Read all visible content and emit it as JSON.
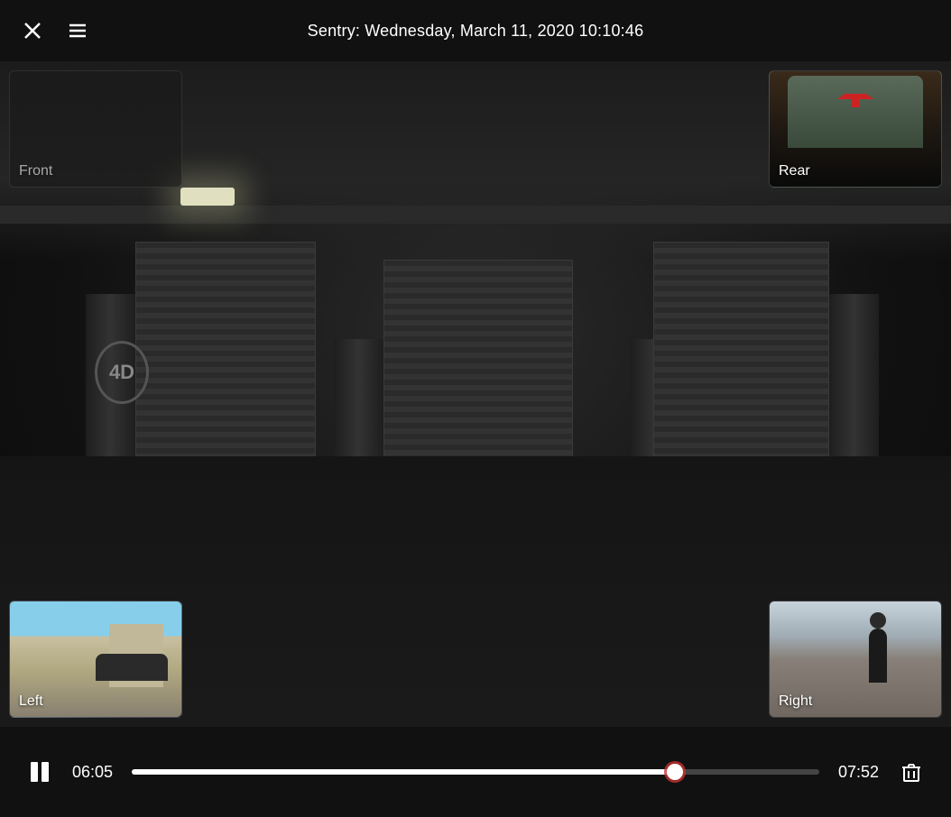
{
  "header": {
    "title": "Sentry: Wednesday, March 11, 2020 10:10:46",
    "close_label": "close",
    "menu_label": "menu"
  },
  "cameras": {
    "front": {
      "label": "Front"
    },
    "rear": {
      "label": "Rear"
    },
    "left": {
      "label": "Left"
    },
    "right": {
      "label": "Right"
    }
  },
  "controls": {
    "time_current": "06:05",
    "time_total": "07:52",
    "play_pause": "pause",
    "scrubber_percent": 79,
    "delete_label": "delete"
  }
}
